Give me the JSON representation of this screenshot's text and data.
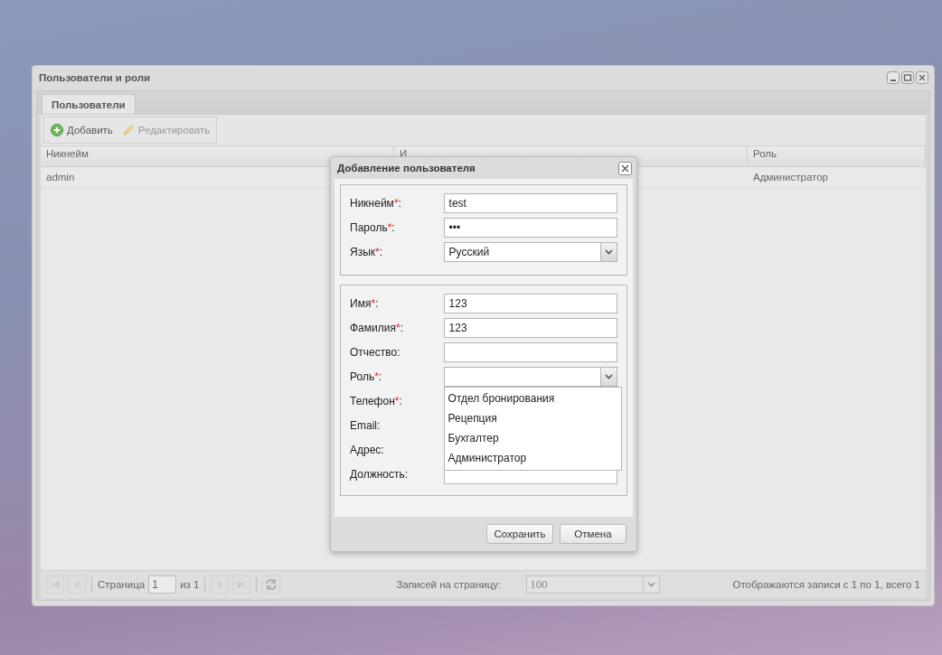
{
  "window": {
    "title": "Пользователи и роли"
  },
  "tabs": [
    {
      "label": "Пользователи",
      "selected": true
    }
  ],
  "toolbar": [
    {
      "label": "Добавить",
      "kind": "add",
      "disabled": false
    },
    {
      "label": "Редактировать",
      "kind": "edit",
      "disabled": true
    }
  ],
  "table": {
    "columns": [
      "Никнейм",
      "И",
      "Роль"
    ],
    "rows": [
      [
        "admin",
        "",
        "Администратор"
      ]
    ]
  },
  "paging": {
    "page_label": "Страница",
    "page": "1",
    "of": "из 1",
    "per_page_label": "Записей на страницу:",
    "per_page": "100",
    "summary": "Отображаются записи с 1 по 1, всего 1"
  },
  "dialog": {
    "title": "Добавление пользователя",
    "fieldsets": [
      {
        "fields": [
          {
            "label": "Никнейм",
            "mark": "*",
            "separator": ":",
            "kind": "text",
            "value": "test"
          },
          {
            "label": "Пароль",
            "mark": "*",
            "separator": ":",
            "kind": "text",
            "value": "•••"
          },
          {
            "label": "Язык",
            "mark": "*",
            "separator": ":",
            "kind": "combo",
            "value": "Русский"
          }
        ]
      },
      {
        "fields": [
          {
            "label": "Имя",
            "mark": "*",
            "separator": ":",
            "kind": "text",
            "value": "123"
          },
          {
            "label": "Фамилия",
            "mark": "*",
            "separator": ":",
            "kind": "text",
            "value": "123"
          },
          {
            "label": "Отчество",
            "separator": ":",
            "kind": "text"
          },
          {
            "label": "Роль",
            "mark": "*",
            "separator": ":",
            "kind": "combo",
            "expanded": true,
            "options": [
              "Отдел бронирования",
              "Рецепция",
              "Бухгалтер",
              "Администратор"
            ]
          },
          {
            "label": "Телефон",
            "mark": "*",
            "separator": ":",
            "kind": "hidden"
          },
          {
            "label": "Email",
            "separator": ":",
            "kind": "hidden"
          },
          {
            "label": "Адрес",
            "separator": ":",
            "kind": "hidden"
          },
          {
            "label": "Должность",
            "separator": ":",
            "kind": "text"
          }
        ]
      }
    ],
    "buttons": [
      "Сохранить",
      "Отмена"
    ]
  }
}
